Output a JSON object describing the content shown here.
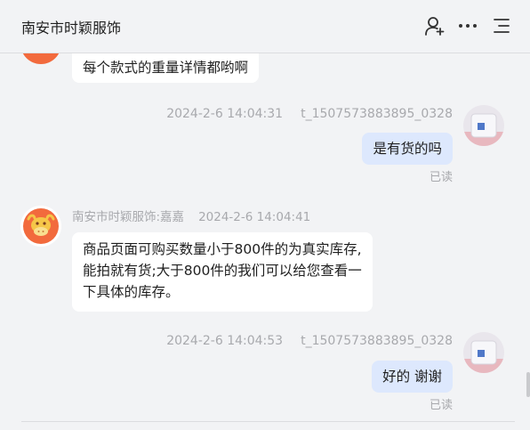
{
  "header": {
    "title": "南安市时颖服饰",
    "icons": [
      "add-user-icon",
      "more-icon",
      "menu-icon"
    ]
  },
  "messages": [
    {
      "direction": "in",
      "text_lines": [
        "每个款式的重量详情都哟啊"
      ]
    },
    {
      "direction": "out",
      "time": "2024-2-6 14:04:31",
      "sender": "t_1507573883895_0328",
      "text_lines": [
        "是有货的吗"
      ],
      "status": "已读"
    },
    {
      "direction": "in",
      "sender": "南安市时颖服饰:嘉嘉",
      "time": "2024-2-6 14:04:41",
      "text_lines": [
        "商品页面可购买数量小于800件的为真实库存,",
        "能拍就有货;大于800件的我们可以给您查看一",
        "下具体的库存。"
      ]
    },
    {
      "direction": "out",
      "time": "2024-2-6 14:04:53",
      "sender": "t_1507573883895_0328",
      "text_lines": [
        "好的 谢谢"
      ],
      "status": "已读"
    }
  ],
  "colors": {
    "background": "#f2f3f5",
    "incoming_bubble": "#ffffff",
    "outgoing_bubble": "#dde8fd",
    "meta_text": "#a8a9ad",
    "shop_avatar": "#f26a3d"
  }
}
